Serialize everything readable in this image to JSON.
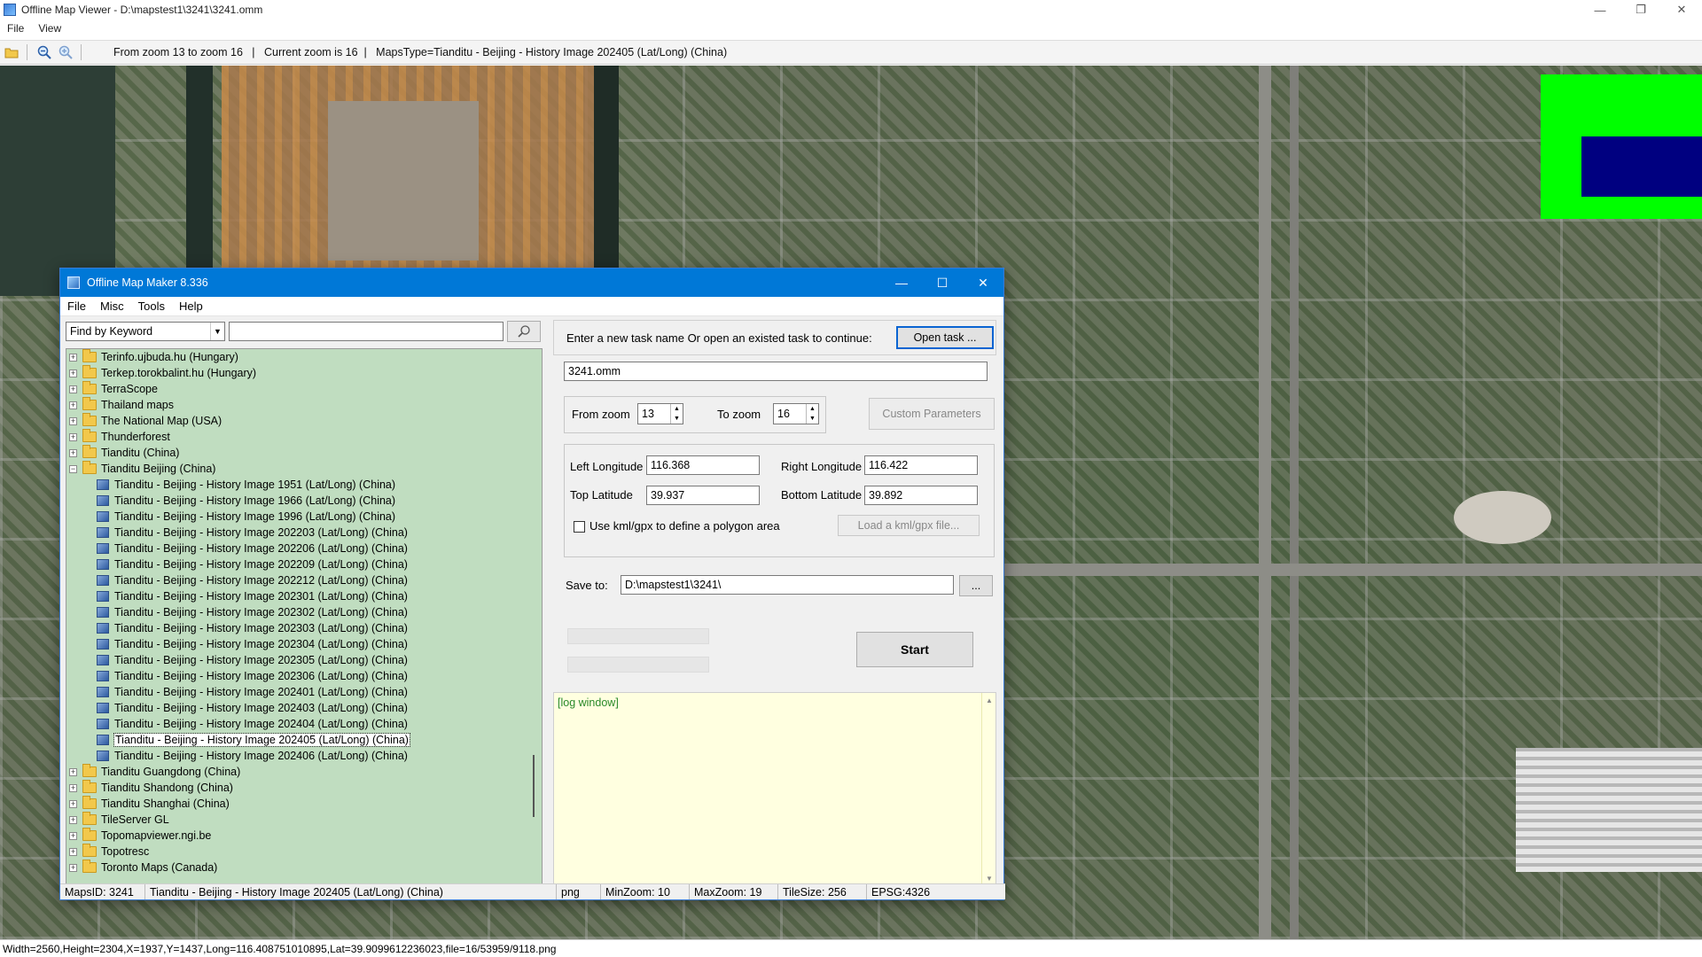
{
  "window": {
    "title": "Offline Map Viewer - D:\\mapstest1\\3241\\3241.omm",
    "controls": [
      "—",
      "❐",
      "✕"
    ]
  },
  "menu": [
    "File",
    "View"
  ],
  "toolbar": {
    "info": "From zoom 13 to zoom 16   |   Current zoom is 16  |   MapsType=Tianditu - Beijing - History Image 202405 (Lat/Long) (China)"
  },
  "statusbar": {
    "text": "Width=2560,Height=2304,X=1937,Y=1437,Long=116.408751010895,Lat=39.9099612236023,file=16/53959/9118.png"
  },
  "dialog": {
    "title": "Offline Map Maker 8.336",
    "controls": [
      "—",
      "☐",
      "✕"
    ],
    "menu": [
      "File",
      "Misc",
      "Tools",
      "Help"
    ],
    "find": {
      "mode": "Find by Keyword",
      "query": "",
      "placeholder": ""
    },
    "tree": {
      "groups_before": [
        "Terinfo.ujbuda.hu (Hungary)",
        "Terkep.torokbalint.hu (Hungary)",
        "TerraScope",
        "Thailand maps",
        "The National Map (USA)",
        "Thunderforest",
        "Tianditu (China)"
      ],
      "expanded_group": "Tianditu Beijing (China)",
      "children": [
        "Tianditu - Beijing - History Image 1951 (Lat/Long) (China)",
        "Tianditu - Beijing - History Image 1966 (Lat/Long) (China)",
        "Tianditu - Beijing - History Image 1996 (Lat/Long) (China)",
        "Tianditu - Beijing - History Image 202203 (Lat/Long) (China)",
        "Tianditu - Beijing - History Image 202206 (Lat/Long) (China)",
        "Tianditu - Beijing - History Image 202209 (Lat/Long) (China)",
        "Tianditu - Beijing - History Image 202212 (Lat/Long) (China)",
        "Tianditu - Beijing - History Image 202301 (Lat/Long) (China)",
        "Tianditu - Beijing - History Image 202302 (Lat/Long) (China)",
        "Tianditu - Beijing - History Image 202303 (Lat/Long) (China)",
        "Tianditu - Beijing - History Image 202304 (Lat/Long) (China)",
        "Tianditu - Beijing - History Image 202305 (Lat/Long) (China)",
        "Tianditu - Beijing - History Image 202306 (Lat/Long) (China)",
        "Tianditu - Beijing - History Image 202401 (Lat/Long) (China)",
        "Tianditu - Beijing - History Image 202403 (Lat/Long) (China)",
        "Tianditu - Beijing - History Image 202404 (Lat/Long) (China)",
        "Tianditu - Beijing - History Image 202405 (Lat/Long) (China)",
        "Tianditu - Beijing - History Image 202406 (Lat/Long) (China)"
      ],
      "selected_child": "Tianditu - Beijing - History Image 202405 (Lat/Long) (China)",
      "groups_after": [
        "Tianditu Guangdong (China)",
        "Tianditu Shandong (China)",
        "Tianditu Shanghai (China)",
        "TileServer GL",
        "Topomapviewer.ngi.be",
        "Topotresc",
        "Toronto Maps (Canada)"
      ]
    },
    "task": {
      "prompt": "Enter a new task name Or open an existed task to continue:",
      "open_button": "Open task ...",
      "name": "3241.omm"
    },
    "zoom": {
      "from_label": "From zoom",
      "from_value": "13",
      "to_label": "To zoom",
      "to_value": "16",
      "custom_button": "Custom Parameters"
    },
    "bounds": {
      "left_lon_label": "Left Longitude",
      "left_lon": "116.368",
      "right_lon_label": "Right Longitude",
      "right_lon": "116.422",
      "top_lat_label": "Top Latitude",
      "top_lat": "39.937",
      "bottom_lat_label": "Bottom Latitude",
      "bottom_lat": "39.892",
      "kml_label": "Use kml/gpx to define a polygon area",
      "kml_checked": false,
      "kml_button": "Load a kml/gpx file..."
    },
    "save": {
      "label": "Save to:",
      "path": "D:\\mapstest1\\3241\\",
      "browse_button": "..."
    },
    "start_button": "Start",
    "log": "[log window]",
    "status": {
      "maps_id": "MapsID: 3241",
      "maps_name": "Tianditu - Beijing - History Image 202405 (Lat/Long) (China)",
      "format": "png",
      "min_zoom": "MinZoom: 10",
      "max_zoom": "MaxZoom: 19",
      "tile_size": "TileSize: 256",
      "epsg": "EPSG:4326"
    }
  }
}
